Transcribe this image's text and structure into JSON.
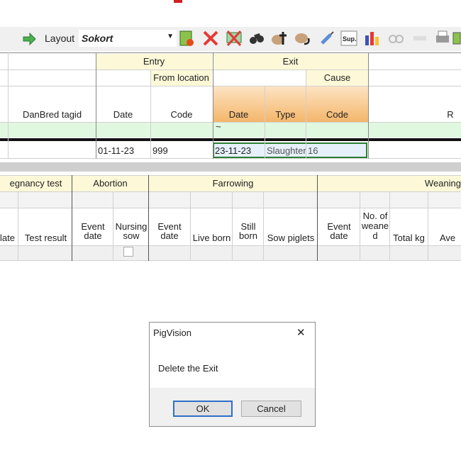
{
  "toolbar": {
    "layout_label": "Layout",
    "layout_value": "Sokort",
    "icons": [
      "arrow-right-icon",
      "report-icon",
      "delete-icon",
      "remove-filter-icon",
      "binoculars-icon",
      "pig-cross-icon",
      "pig-arrow-icon",
      "syringe-icon",
      "sup-icon",
      "bar-chart-icon",
      "cycle-icon",
      "flat-icon",
      "printer-icon",
      "export-icon"
    ],
    "sup_text": "Sup."
  },
  "top_grid": {
    "group_headers": {
      "entry": "Entry",
      "exit": "Exit"
    },
    "sub_headers": {
      "from_location": "From location",
      "cause": "Cause"
    },
    "columns": {
      "danbred_tagid": "DanBred tagid",
      "entry_date": "Date",
      "entry_code": "Code",
      "exit_date": "Date",
      "exit_type": "Type",
      "exit_code": "Code",
      "right_cut": "R"
    },
    "filter_row": {
      "exit_date": "~"
    },
    "data_row": {
      "entry_date": "01-11-23",
      "entry_code": "999",
      "exit_date": "23-11-23",
      "exit_type": "Slaughter",
      "exit_code": "16"
    }
  },
  "bottom_grid": {
    "group_headers": {
      "pregnancy": "egnancy test",
      "abortion": "Abortion",
      "farrowing": "Farrowing",
      "weaning": "Weaning"
    },
    "columns": {
      "date_cut": "late",
      "test_result": "Test result",
      "abortion_event_date": "Event\ndate",
      "nursing_sow": "Nursing\nsow",
      "farrowing_event_date": "Event\ndate",
      "live_born": "Live born",
      "still_born": "Still\nborn",
      "sow_piglets": "Sow piglets",
      "weaning_event_date": "Event\ndate",
      "no_weaned": "No. of\nweane\nd",
      "total_kg": "Total kg",
      "ave": "Ave"
    }
  },
  "dialog": {
    "title": "PigVision",
    "message": "Delete the Exit",
    "ok_label": "OK",
    "cancel_label": "Cancel",
    "close_glyph": "✕"
  }
}
